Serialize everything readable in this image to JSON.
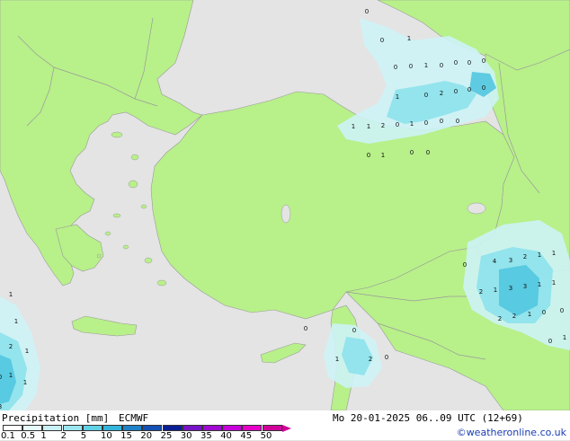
{
  "map": {
    "colors": {
      "sea": "#e4e4e4",
      "land": "#b8f08a",
      "border": "#9a9a9a",
      "precip_light": "#cdf3f6",
      "precip_mid": "#8fe3ec",
      "precip_heavy": "#52c6e0"
    },
    "labels": [
      {
        "text": "0"
      },
      {
        "text": "1"
      },
      {
        "text": "0"
      },
      {
        "text": "0"
      },
      {
        "text": "0"
      },
      {
        "text": "1"
      },
      {
        "text": "0"
      },
      {
        "text": "0"
      },
      {
        "text": "0"
      },
      {
        "text": "0"
      },
      {
        "text": "1"
      },
      {
        "text": "0"
      },
      {
        "text": "2"
      },
      {
        "text": "0"
      },
      {
        "text": "0"
      },
      {
        "text": "0"
      },
      {
        "text": "1"
      },
      {
        "text": "1"
      },
      {
        "text": "2"
      },
      {
        "text": "0"
      },
      {
        "text": "1"
      },
      {
        "text": "0"
      },
      {
        "text": "0"
      },
      {
        "text": "0"
      },
      {
        "text": "1"
      },
      {
        "text": "0"
      },
      {
        "text": "0"
      },
      {
        "text": "0"
      },
      {
        "text": "0"
      },
      {
        "text": "4"
      },
      {
        "text": "3"
      },
      {
        "text": "2"
      },
      {
        "text": "1"
      },
      {
        "text": "1"
      },
      {
        "text": "2"
      },
      {
        "text": "1"
      },
      {
        "text": "3"
      },
      {
        "text": "3"
      },
      {
        "text": "1"
      },
      {
        "text": "1"
      },
      {
        "text": "0"
      },
      {
        "text": "2"
      },
      {
        "text": "2"
      },
      {
        "text": "1"
      },
      {
        "text": "0"
      },
      {
        "text": "0"
      },
      {
        "text": "1"
      },
      {
        "text": "0"
      },
      {
        "text": "1"
      },
      {
        "text": "2"
      },
      {
        "text": "0"
      },
      {
        "text": "0"
      },
      {
        "text": "1"
      },
      {
        "text": "1"
      },
      {
        "text": "2"
      },
      {
        "text": "1"
      },
      {
        "text": "0"
      },
      {
        "text": "1"
      },
      {
        "text": "3"
      },
      {
        "text": "1"
      }
    ]
  },
  "footer": {
    "title": "Precipitation [mm]",
    "model": "ECMWF",
    "datetime": "Mo 20-01-2025 06..09 UTC (12+69)",
    "credit": "©weatheronline.co.uk",
    "colorbar": [
      {
        "label": "0.1",
        "color": "#ffffff"
      },
      {
        "label": "0.5",
        "color": "#e6fafa"
      },
      {
        "label": "1",
        "color": "#c8f0f5"
      },
      {
        "label": "2",
        "color": "#9be6ef"
      },
      {
        "label": "5",
        "color": "#5fd2e6"
      },
      {
        "label": "10",
        "color": "#32b4dc"
      },
      {
        "label": "15",
        "color": "#1e82c8"
      },
      {
        "label": "20",
        "color": "#1450b4"
      },
      {
        "label": "25",
        "color": "#0a1e96"
      },
      {
        "label": "30",
        "color": "#7814c8"
      },
      {
        "label": "35",
        "color": "#a00ad2"
      },
      {
        "label": "40",
        "color": "#c800dc"
      },
      {
        "label": "45",
        "color": "#e600c8"
      },
      {
        "label": "50",
        "color": "#d2009b"
      }
    ]
  }
}
